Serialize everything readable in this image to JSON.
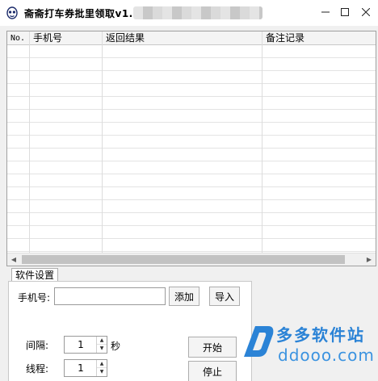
{
  "window": {
    "title": "斋斋打车券批里领取v1.0",
    "icon": "panda-app-icon",
    "controls": {
      "minimize": "minimize-icon",
      "maximize": "maximize-icon",
      "close": "close-icon"
    }
  },
  "grid": {
    "columns": [
      "No.",
      "手机号",
      "返回结果",
      "备注记录"
    ],
    "rows": []
  },
  "settings": {
    "tab_label": "软件设置",
    "phone_label": "手机号:",
    "phone_value": "",
    "add_button": "添加",
    "import_button": "导入",
    "interval_label": "间隔:",
    "interval_value": "1",
    "interval_unit": "秒",
    "threads_label": "线程:",
    "threads_value": "1",
    "start_button": "开始",
    "stop_button": "停止"
  },
  "watermark": {
    "text_cn": "多多软件站",
    "text_en": "ddooo.com",
    "color": "#2b83d6"
  }
}
